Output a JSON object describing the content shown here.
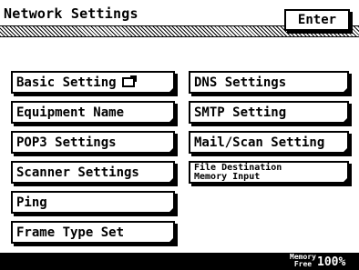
{
  "header": {
    "title": "Network Settings",
    "enter_label": "Enter"
  },
  "left_buttons": [
    {
      "label": "Basic Setting",
      "icon": "edit-icon"
    },
    {
      "label": "Equipment Name"
    },
    {
      "label": "POP3 Settings"
    },
    {
      "label": "Scanner Settings"
    },
    {
      "label": "Ping"
    },
    {
      "label": "Frame Type Set"
    }
  ],
  "right_buttons": [
    {
      "label": "DNS Settings"
    },
    {
      "label": "SMTP Setting"
    },
    {
      "label": "Mail/Scan Setting"
    },
    {
      "label_line1": "File Destination",
      "label_line2": "Memory Input"
    }
  ],
  "status": {
    "memory_label_line1": "Memory",
    "memory_label_line2": "Free",
    "memory_value": "100%"
  }
}
